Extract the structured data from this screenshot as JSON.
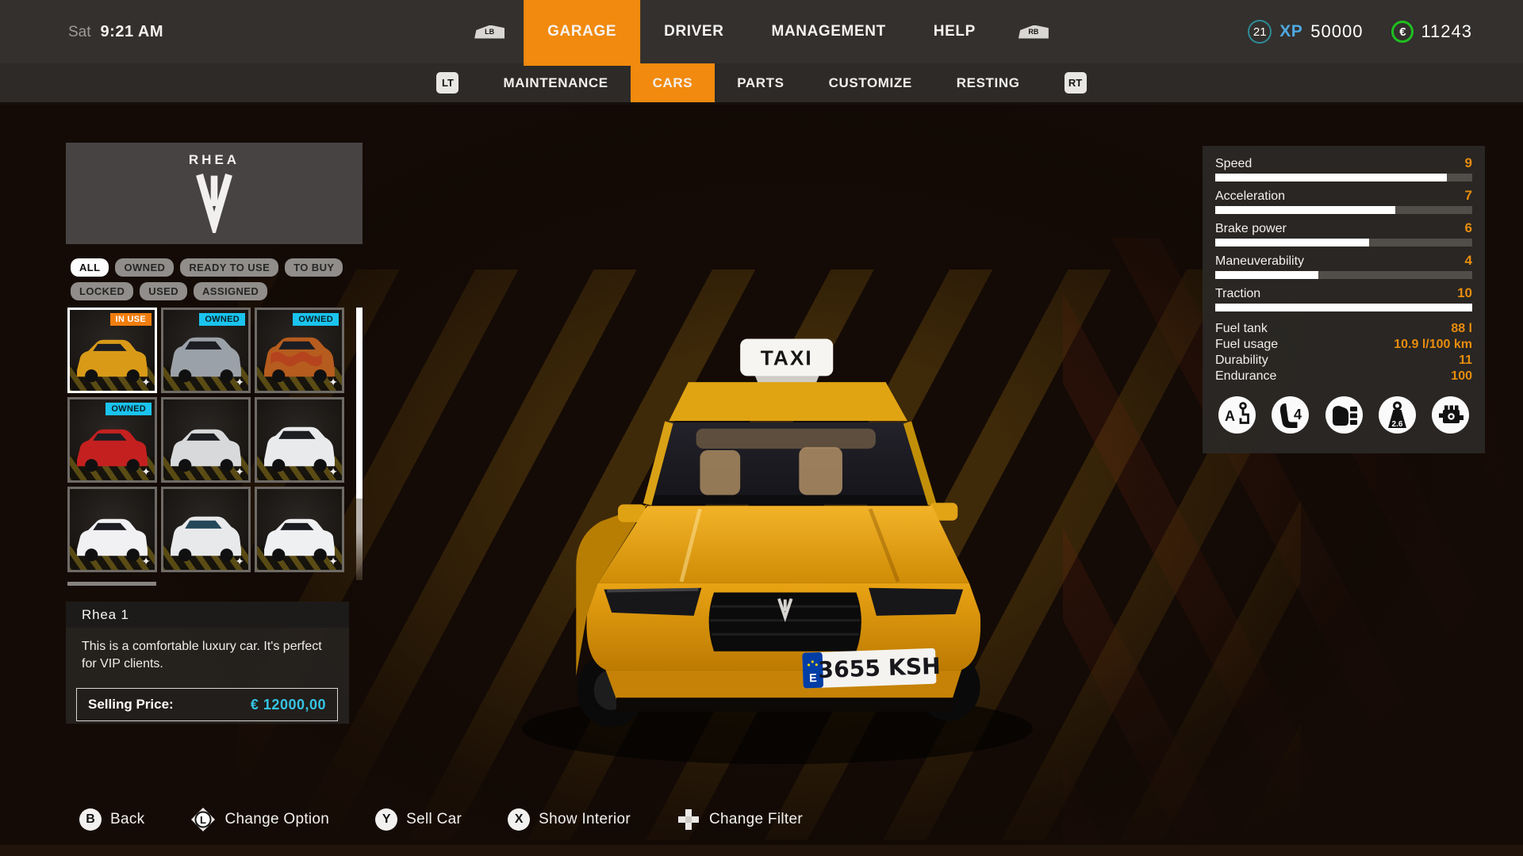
{
  "status_bar": {
    "day": "Sat",
    "time": "9:21 AM"
  },
  "top_nav": {
    "lb_icon": "LB",
    "rb_icon": "RB",
    "tabs": [
      {
        "label": "GARAGE",
        "active": true
      },
      {
        "label": "DRIVER",
        "active": false
      },
      {
        "label": "MANAGEMENT",
        "active": false
      },
      {
        "label": "HELP",
        "active": false
      }
    ],
    "level": "21",
    "xp_label": "XP",
    "xp_value": "50000",
    "currency_symbol": "€",
    "money": "11243"
  },
  "sub_nav": {
    "lt_icon": "LT",
    "rt_icon": "RT",
    "tabs": [
      {
        "label": "MAINTENANCE",
        "active": false
      },
      {
        "label": "CARS",
        "active": true
      },
      {
        "label": "PARTS",
        "active": false
      },
      {
        "label": "CUSTOMIZE",
        "active": false
      },
      {
        "label": "RESTING",
        "active": false
      }
    ]
  },
  "brand": {
    "name": "RHEA"
  },
  "filters": {
    "items": [
      {
        "label": "ALL",
        "active": true
      },
      {
        "label": "OWNED",
        "active": false
      },
      {
        "label": "READY TO USE",
        "active": false
      },
      {
        "label": "TO BUY",
        "active": false
      },
      {
        "label": "LOCKED",
        "active": false
      },
      {
        "label": "USED",
        "active": false
      },
      {
        "label": "ASSIGNED",
        "active": false
      }
    ]
  },
  "garage": {
    "tiles": [
      {
        "badge": "IN USE",
        "selected": true,
        "color": "#d99a18"
      },
      {
        "badge": "OWNED",
        "selected": false,
        "color": "#9ba1a8"
      },
      {
        "badge": "OWNED",
        "selected": false,
        "color": "#b65c1e"
      },
      {
        "badge": "OWNED",
        "selected": false,
        "color": "#c42020"
      },
      {
        "badge": "",
        "selected": false,
        "color": "#d8d9db"
      },
      {
        "badge": "",
        "selected": false,
        "color": "#e9eaec"
      },
      {
        "badge": "",
        "selected": false,
        "color": "#f1f1f3"
      },
      {
        "badge": "",
        "selected": false,
        "color": "#e8e9eb"
      },
      {
        "badge": "",
        "selected": false,
        "color": "#eff0f2"
      }
    ]
  },
  "car_info": {
    "name": "Rhea 1",
    "description": "This is a comfortable luxury car. It's perfect for VIP clients.",
    "selling_price_label": "Selling Price:",
    "selling_price_value": "€ 12000,00"
  },
  "stats": {
    "max": 10,
    "bars": [
      {
        "label": "Speed",
        "value": 9
      },
      {
        "label": "Acceleration",
        "value": 7
      },
      {
        "label": "Brake power",
        "value": 6
      },
      {
        "label": "Maneuverability",
        "value": 4
      },
      {
        "label": "Traction",
        "value": 10
      }
    ],
    "details": [
      {
        "label": "Fuel tank",
        "value": "88 l"
      },
      {
        "label": "Fuel usage",
        "value": "10.9 l/100 km"
      },
      {
        "label": "Durability",
        "value": "11"
      },
      {
        "label": "Endurance",
        "value": "100"
      }
    ],
    "features": [
      {
        "name": "transmission-automatic",
        "label": "A"
      },
      {
        "name": "seats",
        "label": "4"
      },
      {
        "name": "trunk-capacity",
        "label": ""
      },
      {
        "name": "weight-tons",
        "label": "2.6"
      },
      {
        "name": "engine",
        "label": ""
      }
    ]
  },
  "vehicle": {
    "taxi_sign": "TAXI",
    "license_plate": "3655 KSH",
    "plate_country": "E"
  },
  "action_bar": {
    "items": [
      {
        "key": "B",
        "label": "Back"
      },
      {
        "key": "L",
        "label": "Change Option"
      },
      {
        "key": "Y",
        "label": "Sell Car"
      },
      {
        "key": "X",
        "label": "Show Interior"
      },
      {
        "key": "+",
        "label": "Change Filter"
      }
    ]
  },
  "colors": {
    "accent_orange": "#f18a0e",
    "stat_orange": "#e78c0e",
    "price_cyan": "#35c4e4",
    "owned_cyan": "#1ac4ee",
    "xp_blue": "#4fa8df",
    "euro_green": "#1fbf1f"
  }
}
